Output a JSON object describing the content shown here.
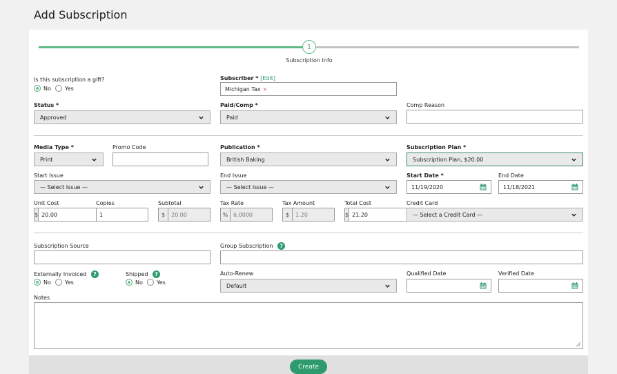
{
  "page": {
    "title": "Add Subscription"
  },
  "stepper": {
    "step_number": "1",
    "step_label": "Subscription Info"
  },
  "gift": {
    "label": "Is this subscription a gift?",
    "no": "No",
    "yes": "Yes",
    "selected": "No"
  },
  "subscriber": {
    "label": "Subscriber *",
    "edit": "[Edit]",
    "value": "Michigan Tax",
    "remove": "×"
  },
  "status": {
    "label": "Status *",
    "value": "Approved"
  },
  "paid_comp": {
    "label": "Paid/Comp *",
    "value": "Paid"
  },
  "comp_reason": {
    "label": "Comp Reason",
    "value": ""
  },
  "media_type": {
    "label": "Media Type *",
    "value": "Print"
  },
  "promo_code": {
    "label": "Promo Code",
    "value": ""
  },
  "publication": {
    "label": "Publication *",
    "value": "British Baking"
  },
  "subscription_plan": {
    "label": "Subscription Plan *",
    "value": "Subscription Plan, $20.00"
  },
  "start_issue": {
    "label": "Start Issue",
    "value": "— Select Issue —"
  },
  "end_issue": {
    "label": "End Issue",
    "value": "— Select Issue —"
  },
  "start_date": {
    "label": "Start Date *",
    "value": "11/19/2020"
  },
  "end_date": {
    "label": "End Date",
    "value": "11/18/2021"
  },
  "unit_cost": {
    "label": "Unit Cost",
    "prefix": "$",
    "value": "20.00"
  },
  "copies": {
    "label": "Copies",
    "value": "1"
  },
  "subtotal": {
    "label": "Subtotal",
    "prefix": "$",
    "value": "20.00"
  },
  "tax_rate": {
    "label": "Tax Rate",
    "prefix": "%",
    "value": "6.0000"
  },
  "tax_amount": {
    "label": "Tax Amount",
    "prefix": "$",
    "value": "1.20"
  },
  "total_cost": {
    "label": "Total Cost",
    "prefix": "$",
    "value": "21.20"
  },
  "credit_card": {
    "label": "Credit Card",
    "value": "— Select a Credit Card —"
  },
  "subscription_source": {
    "label": "Subscription Source",
    "value": ""
  },
  "group_subscription": {
    "label": "Group Subscription",
    "help": "?",
    "value": ""
  },
  "externally_invoiced": {
    "label": "Externally Invoiced",
    "help": "?",
    "no": "No",
    "yes": "Yes",
    "selected": "No"
  },
  "shipped": {
    "label": "Shipped",
    "help": "?",
    "no": "No",
    "yes": "Yes",
    "selected": "No"
  },
  "auto_renew": {
    "label": "Auto-Renew",
    "value": "Default"
  },
  "qualified_date": {
    "label": "Qualified Date",
    "value": ""
  },
  "verified_date": {
    "label": "Verified Date",
    "value": ""
  },
  "notes": {
    "label": "Notes",
    "value": ""
  },
  "actions": {
    "create": "Create"
  },
  "colors": {
    "accent": "#2e9a6d",
    "progress": "#5fba86",
    "background": "#f1f1f1"
  }
}
